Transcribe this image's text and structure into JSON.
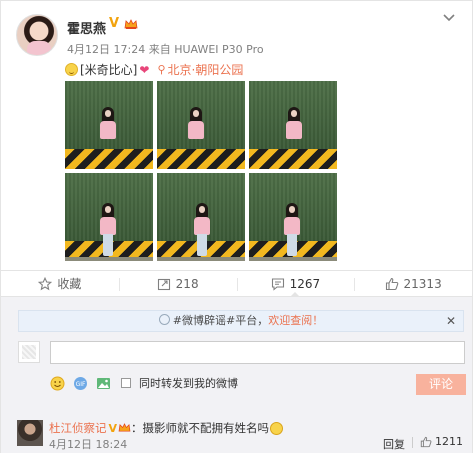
{
  "post": {
    "username": "霍思燕",
    "verified_mark": "V",
    "timestamp": "4月12日 17:24",
    "source_prefix": "来自",
    "source": "HUAWEI P30 Pro",
    "text": "[米奇比心]",
    "location": "北京·朝阳公园",
    "photo_count": 6
  },
  "actions": {
    "favorite_label": "收藏",
    "repost_count": "218",
    "comment_count": "1267",
    "like_count": "21313"
  },
  "comment_box": {
    "notice_prefix": "#微博辟谣#平台，",
    "notice_highlight": "欢迎查阅！",
    "input_value": "",
    "repost_checkbox_label": "同时转发到我的微博",
    "submit_label": "评论"
  },
  "comments": [
    {
      "user": "杜江侦察记",
      "verified_mark": "V",
      "separator": "：",
      "text": "摄影师就不配拥有姓名吗",
      "time": "4月12日 18:24",
      "reply_label": "回复",
      "likes": "1211"
    }
  ],
  "colors": {
    "accent_orange": "#eb7350",
    "verified_gold": "#f2a30f",
    "submit_disabled": "#f8b29d",
    "notice_bg": "#eaf1fa"
  }
}
